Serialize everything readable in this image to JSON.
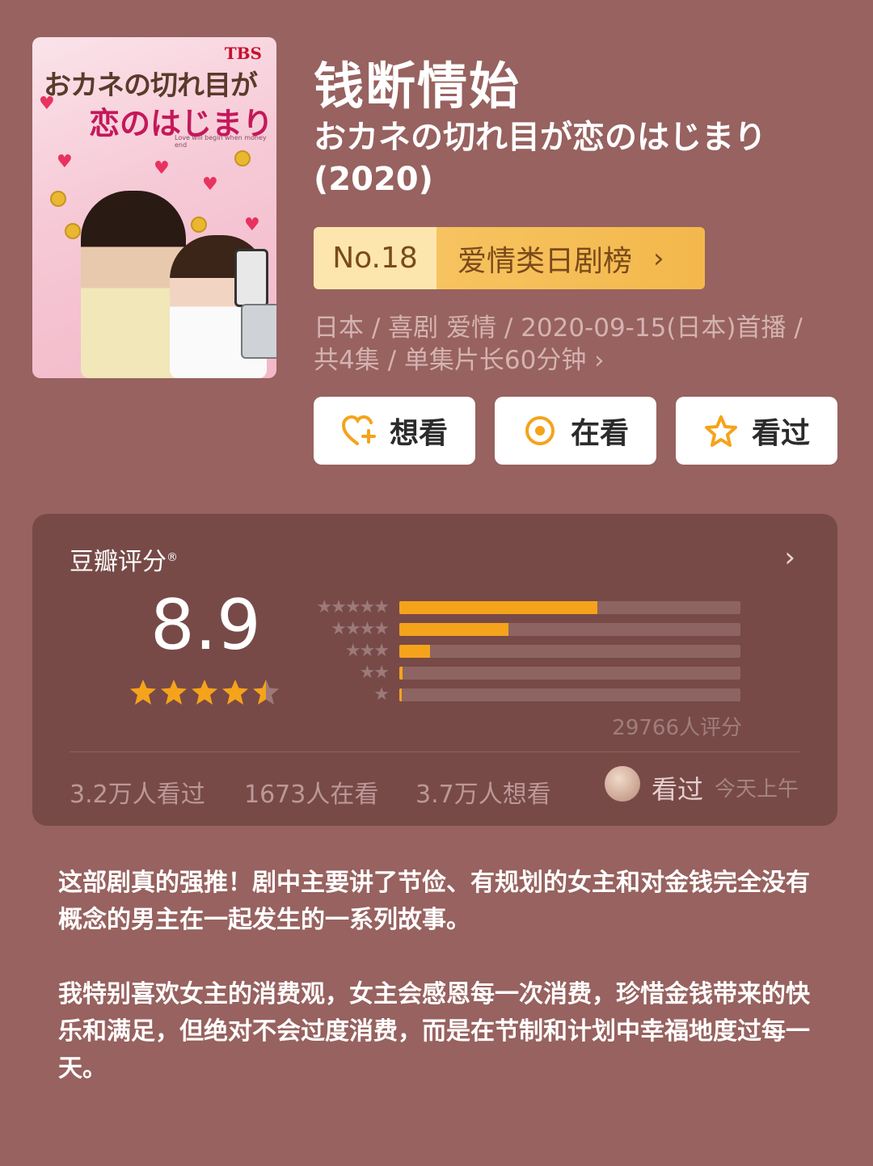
{
  "poster": {
    "network": "TBS",
    "jp_title_line1": "おカネの切れ目が",
    "jp_title_line2": "恋のはじまり",
    "tagline": "Love will begin when money end"
  },
  "title": "钱断情始",
  "subtitle": "おカネの切れ目が恋のはじまり (2020)",
  "ranking": {
    "number": "No.18",
    "category": "爱情类日剧榜",
    "chevron": "›"
  },
  "meta": {
    "line1": "日本 / 喜剧 爱情 / 2020-09-15(日本)首播 /",
    "line2": "共4集 / 单集片长60分钟 ›"
  },
  "actions": [
    {
      "label": "想看",
      "icon": "heart-plus-icon"
    },
    {
      "label": "在看",
      "icon": "target-icon"
    },
    {
      "label": "看过",
      "icon": "star-outline-icon"
    }
  ],
  "rating": {
    "label": "豆瓣评分",
    "registered": "®",
    "chevron": "›",
    "score": "8.9",
    "stars_value": 4.5,
    "distribution": [
      {
        "stars": "★★★★★",
        "fraction": 0.58
      },
      {
        "stars": "★★★★",
        "fraction": 0.32
      },
      {
        "stars": "★★★",
        "fraction": 0.09
      },
      {
        "stars": "★★",
        "fraction": 0.01
      },
      {
        "stars": "★",
        "fraction": 0.005
      }
    ],
    "count": "29766人评分",
    "stats": {
      "watched": "3.2万人看过",
      "watching": "1673人在看",
      "wish": "3.7万人想看"
    },
    "user_status": "看过",
    "user_time": "今天上午"
  },
  "review": {
    "paragraph1": "这部剧真的强推！剧中主要讲了节俭、有规划的女主和对金钱完全没有概念的男主在一起发生的一系列故事。",
    "paragraph2": "我特别喜欢女主的消费观，女主会感恩每一次消费，珍惜金钱带来的快乐和满足，但绝对不会过度消费，而是在节制和计划中幸福地度过每一天。"
  },
  "colors": {
    "background": "#97625f",
    "card": "#774a48",
    "accent": "#f5a31b",
    "badge_light": "#fde6ad",
    "badge_dark": "#f3b84c"
  }
}
